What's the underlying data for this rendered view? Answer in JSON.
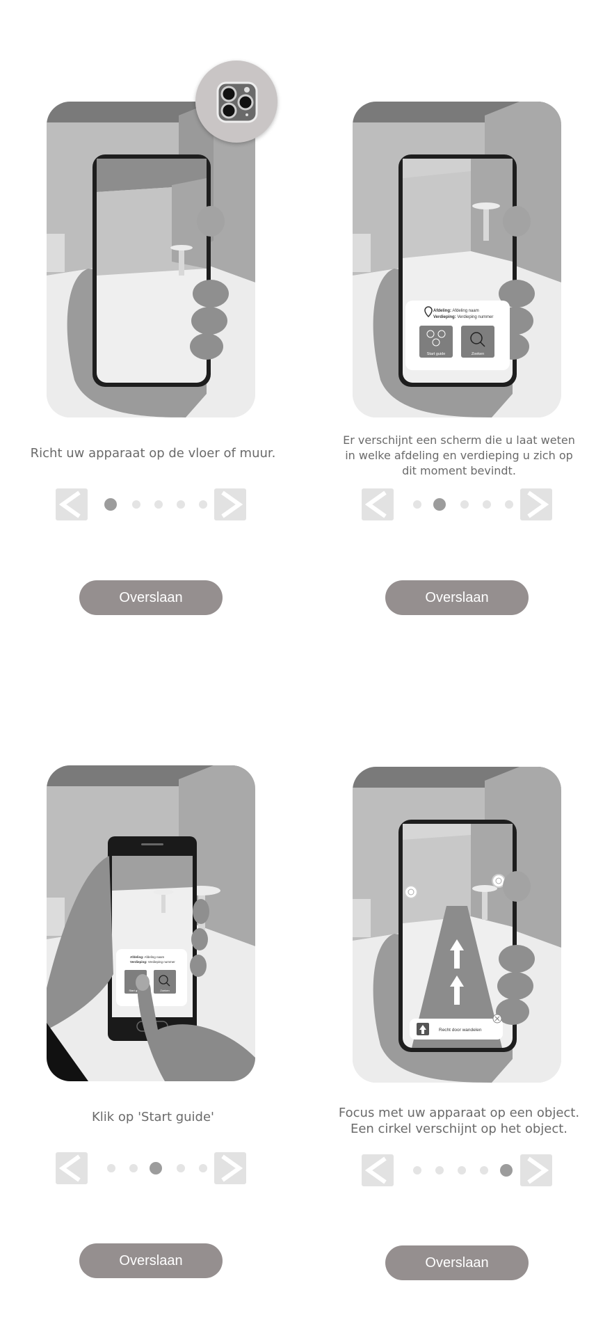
{
  "steps": [
    {
      "caption": "Richt uw apparaat op de vloer of muur.",
      "active_dot": 0,
      "skip_label": "Overslaan",
      "illustration": "phone-pointing-at-floor"
    },
    {
      "caption": "Er verschijnt een scherm die u laat weten in welke afdeling en verdieping u zich op dit moment bevindt.",
      "active_dot": 1,
      "skip_label": "Overslaan",
      "illustration": "phone-location-card",
      "card": {
        "afdeling_label": "Afdeling:",
        "afdeling_value": "Afdeling naam",
        "verdieping_label": "Verdieping:",
        "verdieping_value": "Verdieping nummer",
        "start_guide": "Start guide",
        "zoeken": "Zoeken"
      }
    },
    {
      "caption": "Klik op 'Start guide'",
      "active_dot": 2,
      "skip_label": "Overslaan",
      "illustration": "finger-tapping-start-guide",
      "card": {
        "afdeling_label": "Afdeling:",
        "afdeling_value": "Afdeling naam",
        "verdieping_label": "Verdieping:",
        "verdieping_value": "Verdieping nummer",
        "start_guide": "Start guide",
        "zoeken": "Zoeken"
      }
    },
    {
      "caption": "Focus met uw apparaat op een object. Een cirkel verschijnt op het object.",
      "active_dot": 4,
      "skip_label": "Overslaan",
      "illustration": "phone-ar-arrows",
      "instruction": "Recht door wandelen"
    }
  ],
  "dot_count": 5,
  "icons": {
    "prev": "chevron-left-icon",
    "next": "chevron-right-icon",
    "camera": "camera-lens-icon"
  },
  "colors": {
    "skip_button": "#958f8f",
    "active_dot": "#9c9c9c",
    "inactive_dot": "#e4e4e4",
    "arrow_bg": "#e2e2e2",
    "caption": "#6a6a6a"
  }
}
